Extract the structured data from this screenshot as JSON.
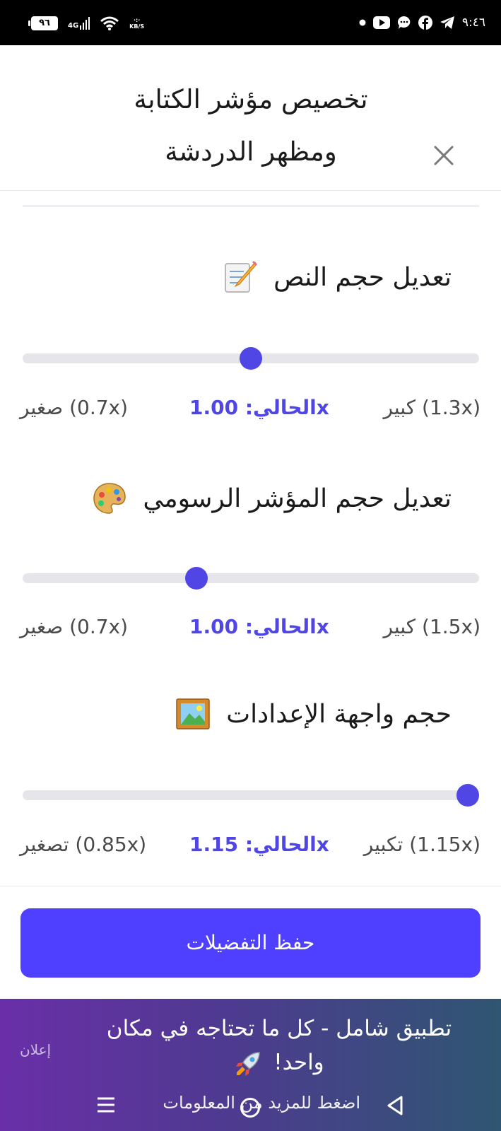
{
  "status_bar": {
    "battery": "٩٦",
    "network": "4G",
    "speed_unit": "KB/S",
    "time": "٩:٤٦",
    "icons": [
      "dot-icon",
      "youtube-icon",
      "chat-icon",
      "facebook-icon",
      "telegram-icon"
    ]
  },
  "header": {
    "title_line1": "تخصيص مؤشر الكتابة",
    "title_line2": "ومظهر الدردشة",
    "close_icon": "close-icon"
  },
  "sections": [
    {
      "title": "تعديل حجم النص",
      "emoji": "memo-icon",
      "label_small": "(0.7x) صغير",
      "label_current": "xالحالي: 1.00",
      "label_large": "(1.3x) كبير",
      "min": 0.7,
      "max": 1.3,
      "value": 1.0
    },
    {
      "title": "تعديل حجم المؤشر الرسومي",
      "emoji": "palette-icon",
      "label_small": "(0.7x) صغير",
      "label_current": "xالحالي: 1.00",
      "label_large": "(1.5x) كبير",
      "min": 0.7,
      "max": 1.5,
      "value": 1.0
    },
    {
      "title": "حجم واجهة الإعدادات",
      "emoji": "framed-picture-icon",
      "label_small": "(0.85x) تصغير",
      "label_current": "xالحالي: 1.15",
      "label_large": "(1.15x) تكبير",
      "min": 0.85,
      "max": 1.15,
      "value": 1.15
    }
  ],
  "save_button": "حفظ التفضيلات",
  "ad": {
    "label": "إعلان",
    "text": "تطبيق شامل - كل ما تحتاجه في مكان واحد!",
    "emoji": "rocket-icon",
    "cta": "اضغط للمزيد من المعلومات"
  },
  "colors": {
    "accent": "#4f46e5",
    "button": "#4f3fff",
    "track": "#e6e6ea"
  }
}
